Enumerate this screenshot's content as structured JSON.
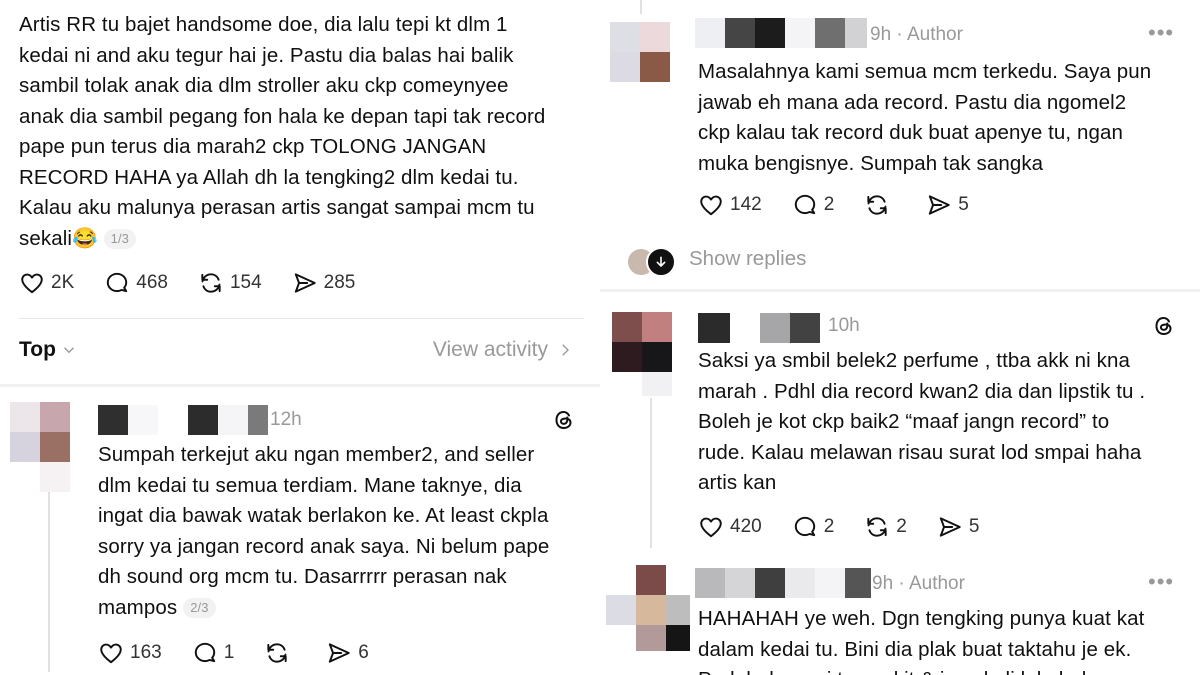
{
  "left": {
    "post": {
      "text": "Artis RR tu bajet handsome doe, dia lalu tepi kt dlm 1\nkedai ni and aku tegur hai je. Pastu dia balas hai balik\nsambil tolak anak dia dlm stroller aku ckp comeynyee\nanak dia sambil pegang fon hala ke depan tapi tak record\npape pun terus dia marah2 ckp TOLONG JANGAN\nRECORD HAHA ya Allah dh la tengking2 dlm kedai tu.\nKalau aku malunya perasan artis sangat sampai mcm tu\nsekali",
      "emoji": "😂",
      "pager": "1/3",
      "likes": "2K",
      "replies": "468",
      "reposts": "154",
      "shares": "285"
    },
    "filter": {
      "label": "Top",
      "view_activity": "View activity"
    },
    "reply": {
      "time": "12h",
      "text": "Sumpah terkejut aku ngan member2, and seller\ndlm kedai tu semua terdiam. Mane taknye, dia\ningat dia bawak watak berlakon ke. At least ckpla\nsorry ya jangan record anak saya. Ni belum pape\ndh sound org mcm tu. Dasarrrrr perasan nak\nmampos",
      "pager": "2/3",
      "likes": "163",
      "replies": "1",
      "shares": "6"
    }
  },
  "right": {
    "author_reply": {
      "time": "9h · Author",
      "text": "Masalahnya kami semua mcm terkedu. Saya pun\njawab eh mana ada record. Pastu dia ngomel2\nckp kalau tak record duk buat apenye tu, ngan\nmuka bengisnye. Sumpah tak sangka",
      "likes": "142",
      "replies": "2",
      "shares": "5"
    },
    "show_replies": "Show replies",
    "reply2": {
      "time": "10h",
      "text": "Saksi ya smbil belek2 perfume , ttba akk ni kna\nmarah . Pdhl dia record kwan2 dia dan lipstik tu .\nBoleh je kot ckp baik2 “maaf jangn record” to\nrude. Kalau melawan risau surat lod smpai haha\nartis kan",
      "likes": "420",
      "replies": "2",
      "reposts": "2",
      "shares": "5"
    },
    "author_reply2": {
      "time": "9h · Author",
      "text": "HAHAHAH ye weh. Dgn tengking punya kuat kat\ndalam kedai tu. Bini dia plak buat taktahu je ek.\nPadahal ramai tau cakit & ja sekali lala hala"
    }
  },
  "icons": {
    "like": "heart-icon",
    "reply": "comment-icon",
    "repost": "repost-icon",
    "share": "share-icon",
    "threads": "threads-logo-icon",
    "more": "more-icon",
    "chevron": "chevron-icon"
  },
  "colors": {
    "text": "#101010",
    "muted": "#999999",
    "divider": "#e6e6e6"
  }
}
